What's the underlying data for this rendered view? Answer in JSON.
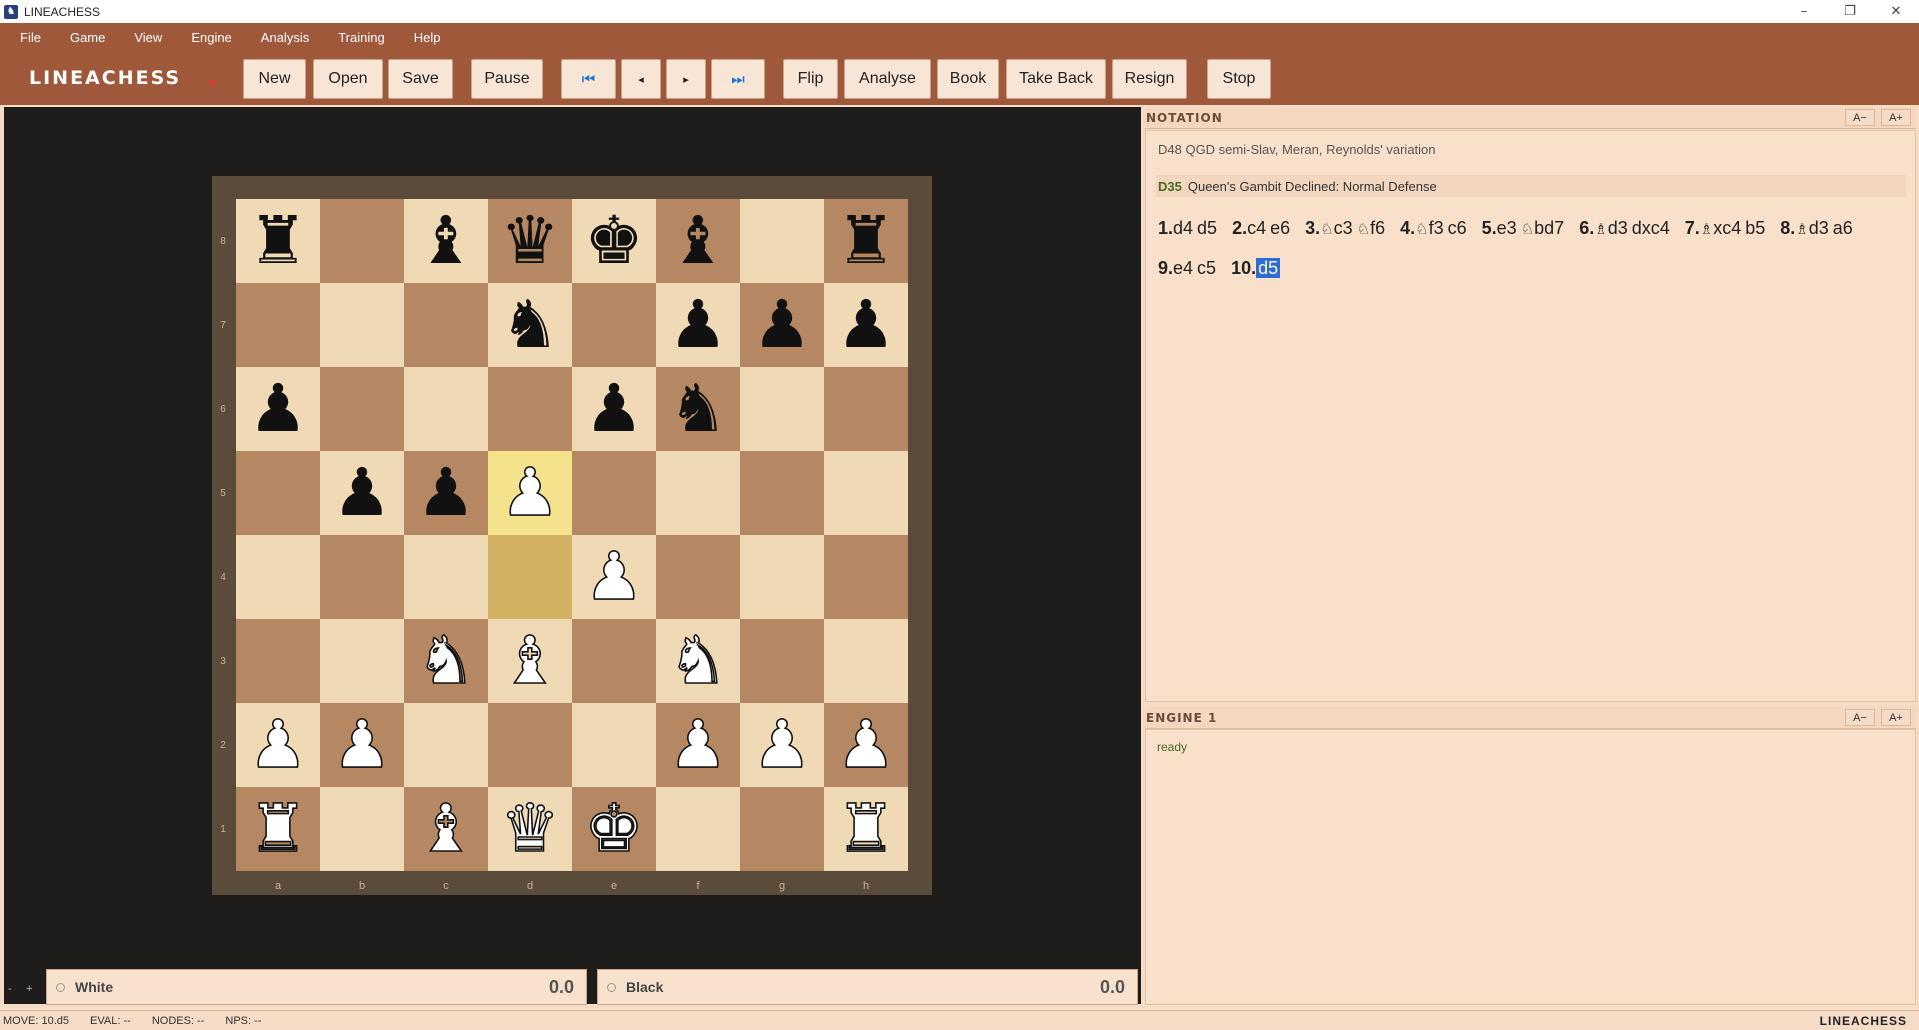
{
  "window": {
    "title": "LINEACHESS",
    "app_icon": "lineachess-app-icon"
  },
  "menu": [
    "File",
    "Game",
    "View",
    "Engine",
    "Analysis",
    "Training",
    "Help"
  ],
  "brand": "LINEACHESS",
  "colors": {
    "toolbar_bg": "#a0583b",
    "panel_bg": "#f9e0cb",
    "board_light": "#f0d9b5",
    "board_dark": "#b58863",
    "highlight": "#f5e28c",
    "selection": "#2d6bd6"
  },
  "toolbar": {
    "new": "New",
    "open": "Open",
    "save": "Save",
    "pause": "Pause",
    "first": "⏮",
    "prev": "◂",
    "next": "▸",
    "last": "⏭",
    "flip": "Flip",
    "analyse": "Analyse",
    "book": "Book",
    "take_back": "Take Back",
    "resign": "Resign",
    "stop": "Stop"
  },
  "board": {
    "ranks": [
      "8",
      "7",
      "6",
      "5",
      "4",
      "3",
      "2",
      "1"
    ],
    "files": [
      "a",
      "b",
      "c",
      "d",
      "e",
      "f",
      "g",
      "h"
    ],
    "position": [
      [
        "r",
        "",
        "b",
        "q",
        "k",
        "b",
        "",
        "r"
      ],
      [
        "",
        "",
        "",
        "n",
        "",
        "p",
        "p",
        "p"
      ],
      [
        "p",
        "",
        "",
        "",
        "p",
        "n",
        "",
        ""
      ],
      [
        "",
        "p",
        "p",
        "P",
        "",
        "",
        "",
        ""
      ],
      [
        "",
        "",
        "",
        "",
        "P",
        "",
        "",
        ""
      ],
      [
        "",
        "",
        "N",
        "B",
        "",
        "N",
        "",
        ""
      ],
      [
        "P",
        "P",
        "",
        "",
        "",
        "P",
        "P",
        "P"
      ],
      [
        "R",
        "",
        "B",
        "Q",
        "K",
        "",
        "",
        "R"
      ]
    ],
    "last_move": {
      "from": "d4",
      "to": "d5"
    }
  },
  "players": {
    "white": {
      "name": "White",
      "score": "0.0"
    },
    "black": {
      "name": "Black",
      "score": "0.0"
    }
  },
  "notation": {
    "header": "NOTATION",
    "opening": "D48 QGD semi-Slav, Meran, Reynolds' variation",
    "eco_code": "D35",
    "eco_name": "Queen's Gambit Declined: Normal Defense",
    "moves": [
      {
        "n": "1.",
        "w": "d4",
        "b": "d5"
      },
      {
        "n": "2.",
        "w": "c4",
        "b": "e6"
      },
      {
        "n": "3.",
        "w": "♘c3",
        "b": "♘f6"
      },
      {
        "n": "4.",
        "w": "♘f3",
        "b": "c6"
      },
      {
        "n": "5.",
        "w": "e3",
        "b": "♘bd7"
      },
      {
        "n": "6.",
        "w": "♗d3",
        "b": "dxc4"
      },
      {
        "n": "7.",
        "w": "♗xc4",
        "b": "b5"
      },
      {
        "n": "8.",
        "w": "♗d3",
        "b": "a6"
      },
      {
        "n": "9.",
        "w": "e4",
        "b": "c5"
      },
      {
        "n": "10.",
        "w": "d5",
        "b": ""
      }
    ],
    "font_minus": "A−",
    "font_plus": "A+"
  },
  "engine": {
    "header": "ENGINE 1",
    "status": "ready"
  },
  "statusbar": {
    "move": "MOVE: 10.d5",
    "eval": "EVAL: --",
    "nodes": "NODES: --",
    "nps": "NPS: --",
    "brand": "LINEACHESS"
  },
  "zoom": {
    "minus": "-",
    "plus": "+"
  }
}
